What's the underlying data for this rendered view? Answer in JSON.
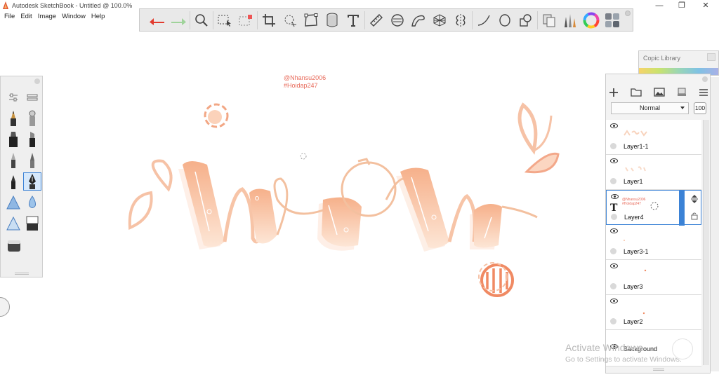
{
  "app": {
    "title": "Autodesk SketchBook - Untitled @ 100.0%",
    "window_controls": {
      "minimize": "—",
      "restore": "❐",
      "close": "✕"
    }
  },
  "menu": [
    "File",
    "Edit",
    "Image",
    "Window",
    "Help"
  ],
  "toolbar": {
    "icons": [
      "undo-icon",
      "redo-icon",
      "zoom-icon",
      "select-icon",
      "transform-select-icon",
      "crop-icon",
      "lasso-icon",
      "distort-icon",
      "fill-icon",
      "text-icon",
      "ruler-icon",
      "ellipse-guide-icon",
      "french-curve-icon",
      "perspective-icon",
      "symmetry-icon",
      "line-icon",
      "circle-icon",
      "shape-icon",
      "copy-icon",
      "brush-library-icon",
      "color-wheel-icon",
      "palette-icon"
    ]
  },
  "brush_palette": {
    "selected": "pen"
  },
  "canvas": {
    "credit_line1": "@Nhansu2006",
    "credit_line2": "#Hoidap247",
    "colors": {
      "fill": "#f6b48f",
      "fill_light": "#fde3d2",
      "stroke": "#f2a785",
      "accent": "#f08a63"
    }
  },
  "copic_library": {
    "title": "Copic Library"
  },
  "layers": {
    "blend_mode": "Normal",
    "opacity": "100",
    "rows": [
      {
        "name": "Layer1-1",
        "selected": false
      },
      {
        "name": "Layer1",
        "selected": false
      },
      {
        "name": "Layer4",
        "selected": true,
        "thumb_text_1": "@Nhansu2006",
        "thumb_text_2": "#Hoidap247"
      },
      {
        "name": "Layer3-1",
        "selected": false
      },
      {
        "name": "Layer3",
        "selected": false
      },
      {
        "name": "Layer2",
        "selected": false
      },
      {
        "name": "Background",
        "selected": false
      }
    ],
    "selected_color": "#3b82d6"
  },
  "watermark": {
    "title": "Activate Windows",
    "subtitle": "Go to Settings to activate Windows."
  }
}
